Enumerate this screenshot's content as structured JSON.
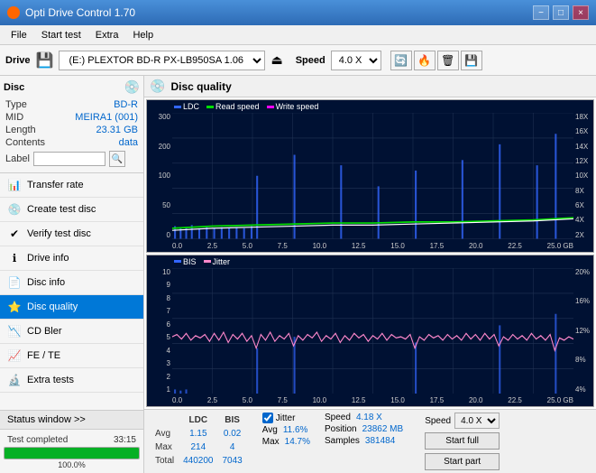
{
  "titlebar": {
    "title": "Opti Drive Control 1.70",
    "icon": "●",
    "min_label": "−",
    "max_label": "□",
    "close_label": "×"
  },
  "menubar": {
    "items": [
      {
        "label": "File"
      },
      {
        "label": "Start test"
      },
      {
        "label": "Extra"
      },
      {
        "label": "Help"
      }
    ]
  },
  "toolbar": {
    "drive_label": "Drive",
    "drive_value": "(E:) PLEXTOR BD-R PX-LB950SA 1.06",
    "speed_label": "Speed",
    "speed_value": "4.0 X"
  },
  "disc_panel": {
    "title": "Disc",
    "type_label": "Type",
    "type_value": "BD-R",
    "mid_label": "MID",
    "mid_value": "MEIRA1 (001)",
    "length_label": "Length",
    "length_value": "23.31 GB",
    "contents_label": "Contents",
    "contents_value": "data",
    "label_label": "Label",
    "label_value": ""
  },
  "nav": {
    "items": [
      {
        "id": "transfer-rate",
        "label": "Transfer rate",
        "icon": "📊"
      },
      {
        "id": "create-test-disc",
        "label": "Create test disc",
        "icon": "💿"
      },
      {
        "id": "verify-test-disc",
        "label": "Verify test disc",
        "icon": "✔"
      },
      {
        "id": "drive-info",
        "label": "Drive info",
        "icon": "ℹ"
      },
      {
        "id": "disc-info",
        "label": "Disc info",
        "icon": "📄"
      },
      {
        "id": "disc-quality",
        "label": "Disc quality",
        "icon": "⭐",
        "active": true
      },
      {
        "id": "cd-bler",
        "label": "CD Bler",
        "icon": "📉"
      },
      {
        "id": "fe-te",
        "label": "FE / TE",
        "icon": "📈"
      },
      {
        "id": "extra-tests",
        "label": "Extra tests",
        "icon": "🔬"
      }
    ]
  },
  "status": {
    "window_btn": "Status window >>",
    "progress": 100,
    "status_text": "Test completed",
    "time": "33:15"
  },
  "disc_quality": {
    "title": "Disc quality",
    "legend": {
      "ldc_label": "LDC",
      "ldc_color": "#0044ff",
      "read_label": "Read speed",
      "read_color": "#00ff00",
      "write_label": "Write speed",
      "write_color": "#ff00ff",
      "bis_label": "BIS",
      "bis_color": "#0044ff",
      "jitter_label": "Jitter",
      "jitter_color": "#ff00ff"
    }
  },
  "chart1": {
    "y_left": [
      "300",
      "200",
      "100",
      "50",
      "0"
    ],
    "y_right": [
      "18X",
      "16X",
      "14X",
      "12X",
      "10X",
      "8X",
      "6X",
      "4X",
      "2X"
    ],
    "x_labels": [
      "0.0",
      "2.5",
      "5.0",
      "7.5",
      "10.0",
      "12.5",
      "15.0",
      "17.5",
      "20.0",
      "22.5",
      "25.0 GB"
    ]
  },
  "chart2": {
    "y_left": [
      "10",
      "9",
      "8",
      "7",
      "6",
      "5",
      "4",
      "3",
      "2",
      "1"
    ],
    "y_right": [
      "20%",
      "16%",
      "12%",
      "8%",
      "4%"
    ],
    "x_labels": [
      "0.0",
      "2.5",
      "5.0",
      "7.5",
      "10.0",
      "12.5",
      "15.0",
      "17.5",
      "20.0",
      "22.5",
      "25.0 GB"
    ]
  },
  "stats": {
    "ldc_header": "LDC",
    "bis_header": "BIS",
    "avg_label": "Avg",
    "avg_ldc": "1.15",
    "avg_bis": "0.02",
    "max_label": "Max",
    "max_ldc": "214",
    "max_bis": "4",
    "total_label": "Total",
    "total_ldc": "440200",
    "total_bis": "7043",
    "jitter_label": "Jitter",
    "jitter_avg": "11.6%",
    "jitter_max": "14.7%",
    "speed_label": "Speed",
    "speed_value": "4.18 X",
    "speed_setting": "4.0 X",
    "position_label": "Position",
    "position_value": "23862 MB",
    "samples_label": "Samples",
    "samples_value": "381484",
    "start_full_label": "Start full",
    "start_part_label": "Start part"
  }
}
